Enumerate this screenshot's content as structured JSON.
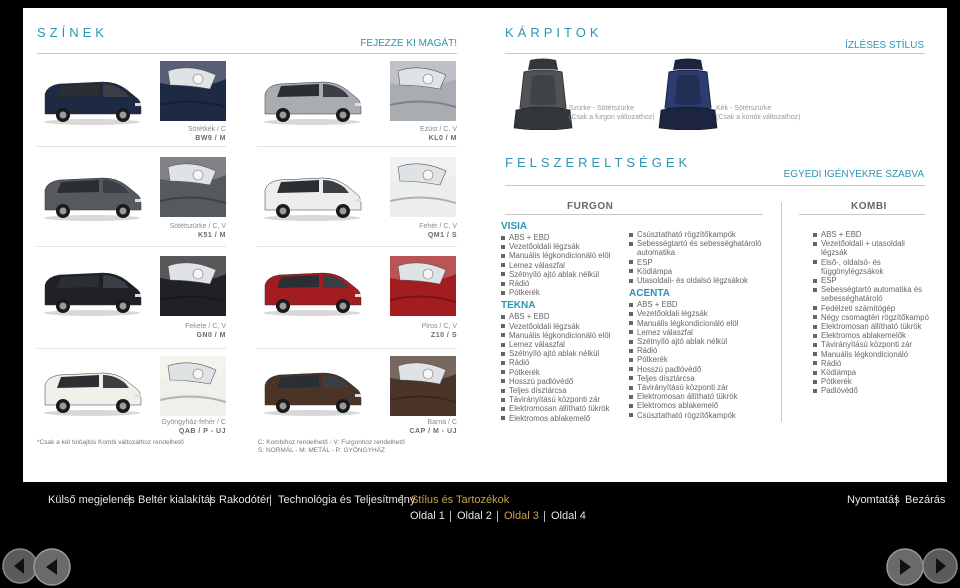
{
  "colors_section": {
    "title": "SZÍNEK",
    "subtitle": "FEJEZZE KI MAGÁT!"
  },
  "upholstery_section": {
    "title": "KÁRPITOK",
    "subtitle": "ÍZLÉSES STÍLUS"
  },
  "equipment_section": {
    "title": "FELSZERELTSÉGEK",
    "subtitle": "EGYEDI IGÉNYEKRE SZABVA"
  },
  "swatches": [
    {
      "name": "Sötétkék / C",
      "code": "BW9 / M",
      "color": "#1e2a44"
    },
    {
      "name": "Ezüst / C, V",
      "code": "KL0 / M",
      "color": "#a9adb2"
    },
    {
      "name": "Sötétszürke / C, V",
      "code": "K51 / M",
      "color": "#56595d"
    },
    {
      "name": "Fehér / C, V",
      "code": "QM1 / S",
      "color": "#eceded"
    },
    {
      "name": "Fekete / C, V",
      "code": "GN0 / M",
      "color": "#202124"
    },
    {
      "name": "Piros / C, V",
      "code": "Z10 / S",
      "color": "#a31c1f"
    },
    {
      "name": "Gyöngyház-fehér / C",
      "code": "QAB / P - UJ",
      "color": "#f1efe9"
    },
    {
      "name": "Barna / C",
      "code": "CAP / M - UJ",
      "color": "#4a3428"
    }
  ],
  "footnotes": {
    "kombi_note": "*Csak a két tolóajtós Kombi változathoz rendelhető",
    "legend_line1": "C: Kombihoz rendelhető - V: Furgonhoz rendelhető",
    "legend_line2": "S: NORMÁL - M: METÁL - P: GYÖNGYHÁZ"
  },
  "seats": [
    {
      "line1": "Szürke - Sötétszürke",
      "line2": "(Csak a furgon változathoz)",
      "color": "#4f5256",
      "accent": "#33363a"
    },
    {
      "line1": "Kék - Sötétszürke",
      "line2": "(Csak a kombi változathoz)",
      "color": "#2c3c70",
      "accent": "#1d2440"
    }
  ],
  "equipment": {
    "furgon_header": "FURGON",
    "kombi_header": "KOMBI",
    "visia": {
      "title": "VISIA",
      "items": [
        "ABS + EBD",
        "Vezetőoldali légzsák",
        "Manuális légkondicionáló elöl",
        "Lemez válaszfal",
        "Szétnyíló ajtó ablak nélkül",
        "Rádió",
        "Pótkerék"
      ]
    },
    "tekna": {
      "title": "TEKNA",
      "items": [
        "ABS + EBD",
        "Vezetőoldali légzsák",
        "Manuális légkondicionáló elöl",
        "Lemez válaszfal",
        "Szétnyíló ajtó ablak nélkül",
        "Rádió",
        "Pótkerék",
        "Hosszú padlóvédő",
        "Teljes dísztárcsa",
        "Távirányítású központi zár",
        "Elektromosan állítható tükrök",
        "Elektromos ablakemelő"
      ]
    },
    "furgon_extra": {
      "items": [
        "Csúsztatható rögzítőkampók",
        "Sebességtartó és sebességhatároló automatika",
        "ESP",
        "Ködlámpa",
        "Utasoldali- és oldalsó légzsákok"
      ]
    },
    "acenta": {
      "title": "ACENTA",
      "items": [
        "ABS + EBD",
        "Vezetőoldali légzsák",
        "Manuális légkondicionáló elöl",
        "Lemez válaszfal",
        "Szétnyíló ajtó ablak nélkül",
        "Rádió",
        "Pótkerék",
        "Hosszú padlóvédő",
        "Teljes dísztárcsa",
        "Távirányítású központi zár",
        "Elektromosan állítható tükrök",
        "Elektromos ablakemelő",
        "Csúsztatható rögzítőkampók"
      ]
    },
    "kombi": {
      "items": [
        "ABS + EBD",
        "Vezetőoldali + utasoldali légzsák",
        "Első-, oldalsó- és függönylégzsákok",
        "ESP",
        "Sebességtartó automatika és sebességhatároló",
        "Fedélzeti számítógép",
        "Négy csomagtéri rögzítőkampó",
        "Elektromosan állítható tükrök",
        "Elektromos ablakemelők",
        "Távirányítású központi zár",
        "Manuális légkondicionáló",
        "Rádió",
        "Ködlámpa",
        "Pótkerék",
        "Padlóvédő"
      ]
    }
  },
  "nav": {
    "main": [
      "Külső megjelenés",
      "Beltér kialakítás",
      "Rakodótér",
      "Technológia és Teljesítmény",
      "Stílus és Tartozékok"
    ],
    "right": [
      "Nyomtatás",
      "Bezárás"
    ],
    "pages": [
      "Oldal 1",
      "Oldal 2",
      "Oldal 3",
      "Oldal 4"
    ],
    "active_main": "Stílus és Tartozékok",
    "active_page": "Oldal 3",
    "accent": "#c9a24a"
  }
}
